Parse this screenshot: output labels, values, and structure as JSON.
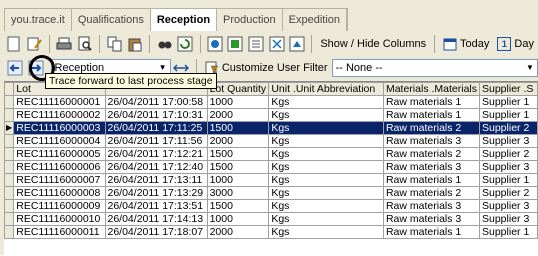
{
  "tabs": [
    {
      "label": "you.trace.it",
      "active": false
    },
    {
      "label": "Qualifications",
      "active": false
    },
    {
      "label": "Reception",
      "active": true
    },
    {
      "label": "Production",
      "active": false
    },
    {
      "label": "Expedition",
      "active": false
    }
  ],
  "toolbar1": {
    "icons": [
      "new-icon",
      "edit-icon",
      "print-icon",
      "print-preview-icon",
      "copy-icon",
      "paste-icon",
      "find-icon",
      "refresh-icon",
      "record-icon",
      "grid-icon",
      "columns-icon",
      "export-icon",
      "import-icon"
    ],
    "show_hide_columns": "Show / Hide Columns",
    "today": "Today",
    "today_badge": "1",
    "day": "Day"
  },
  "toolbar2": {
    "stage_value": "Reception",
    "customize_filter": "Customize User Filter",
    "filter_value": "-- None --"
  },
  "tooltip": "Trace forward to last process stage",
  "grid": {
    "columns": [
      "Lot",
      "",
      "Lot Quantity",
      "Unit .Unit Abbreviation",
      "Materials .Materials",
      "Supplier .S"
    ],
    "rows": [
      [
        "REC11116000001",
        "26/04/2011 17:00:58",
        "1000",
        "Kgs",
        "Raw materials 1",
        "Supplier 1"
      ],
      [
        "REC11116000002",
        "26/04/2011 17:10:31",
        "2000",
        "Kgs",
        "Raw materials 1",
        "Supplier 1"
      ],
      [
        "REC11116000003",
        "26/04/2011 17:11:25",
        "1500",
        "Kgs",
        "Raw materials 2",
        "Supplier 2"
      ],
      [
        "REC11116000004",
        "26/04/2011 17:11:56",
        "2000",
        "Kgs",
        "Raw materials 3",
        "Supplier 3"
      ],
      [
        "REC11116000005",
        "26/04/2011 17:12:21",
        "1500",
        "Kgs",
        "Raw materials 2",
        "Supplier 2"
      ],
      [
        "REC11116000006",
        "26/04/2011 17:12:40",
        "1500",
        "Kgs",
        "Raw materials 3",
        "Supplier 3"
      ],
      [
        "REC11116000007",
        "26/04/2011 17:13:11",
        "1000",
        "Kgs",
        "Raw materials 1",
        "Supplier 1"
      ],
      [
        "REC11116000008",
        "26/04/2011 17:13:29",
        "3000",
        "Kgs",
        "Raw materials 2",
        "Supplier 2"
      ],
      [
        "REC11116000009",
        "26/04/2011 17:13:51",
        "1500",
        "Kgs",
        "Raw materials 3",
        "Supplier 3"
      ],
      [
        "REC11116000010",
        "26/04/2011 17:14:13",
        "1000",
        "Kgs",
        "Raw materials 3",
        "Supplier 3"
      ],
      [
        "REC11116000011",
        "26/04/2011 17:18:07",
        "2000",
        "Kgs",
        "Raw materials 1",
        "Supplier 1"
      ]
    ],
    "selected_row": 2
  }
}
